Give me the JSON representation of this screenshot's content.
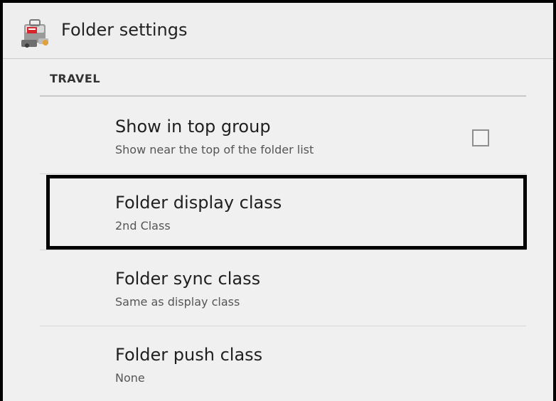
{
  "action_bar": {
    "icon": "folder-app-icon",
    "title": "Folder settings"
  },
  "section": {
    "header": "TRAVEL"
  },
  "preferences": [
    {
      "title": "Show in top group",
      "summary": "Show near the top of the folder list",
      "widget": "checkbox",
      "checked": false
    },
    {
      "title": "Folder display class",
      "summary": "2nd Class",
      "highlighted": true
    },
    {
      "title": "Folder sync class",
      "summary": "Same as display class"
    },
    {
      "title": "Folder push class",
      "summary": "None"
    }
  ],
  "colors": {
    "background": "#f0f0f0",
    "action_bar": "#eeeeee",
    "highlight_border": "#000000",
    "title_text": "#1f1f1f",
    "summary_text": "#555555"
  }
}
